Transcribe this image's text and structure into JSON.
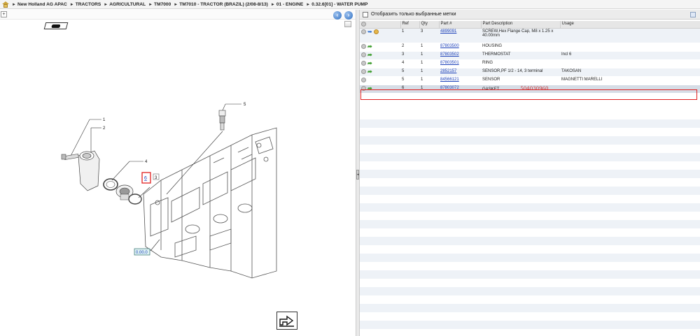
{
  "breadcrumb": {
    "items": [
      "New Holland AG APAC",
      "TRACTORS",
      "AGRICULTURAL",
      "TM7000",
      "TM7010 - TRACTOR (BRAZIL) (2/08-8/13)",
      "01 - ENGINE",
      "0.32.6[01] - WATER PUMP"
    ]
  },
  "diagram": {
    "callouts": [
      "1",
      "2",
      "3",
      "4",
      "5",
      "6"
    ],
    "highlighted_callout": "6",
    "ref_box": "0.00.0"
  },
  "filter": {
    "label": "Отобразить только выбранные метки"
  },
  "table": {
    "columns": [
      "Ref",
      "Qty",
      "Part #",
      "Part Description",
      "Usage"
    ],
    "rows": [
      {
        "ref": "1",
        "qty": "3",
        "part": "4899091",
        "desc": "SCREW,Hex Flange Cap, M8 x 1.25 x 40.00mm",
        "usage": "",
        "icon": "blue"
      },
      {
        "ref": "2",
        "qty": "1",
        "part": "87803500",
        "desc": "HOUSING",
        "usage": "",
        "icon": "green"
      },
      {
        "ref": "3",
        "qty": "1",
        "part": "87803502",
        "desc": "THERMOSTAT",
        "usage": "Incl 6",
        "icon": "green"
      },
      {
        "ref": "4",
        "qty": "1",
        "part": "87803501",
        "desc": "RING",
        "usage": "",
        "icon": "green"
      },
      {
        "ref": "5",
        "qty": "1",
        "part": "2852157",
        "desc": "SENSOR,PF 1/2 - 14, 3 terminal",
        "usage": "TAKOSAN",
        "icon": "green"
      },
      {
        "ref": "5",
        "qty": "1",
        "part": "84566121",
        "desc": "SENSOR",
        "usage": "MAGNETTI MARELLI",
        "icon": "none"
      },
      {
        "ref": "6",
        "qty": "1",
        "part": "87803072",
        "desc": "GASKET",
        "usage": "",
        "icon": "green",
        "note": "504030960"
      }
    ]
  },
  "colors": {
    "selection_outline": "#e02020",
    "link": "#1a3fb8",
    "row_alt": "#eef2f7"
  }
}
